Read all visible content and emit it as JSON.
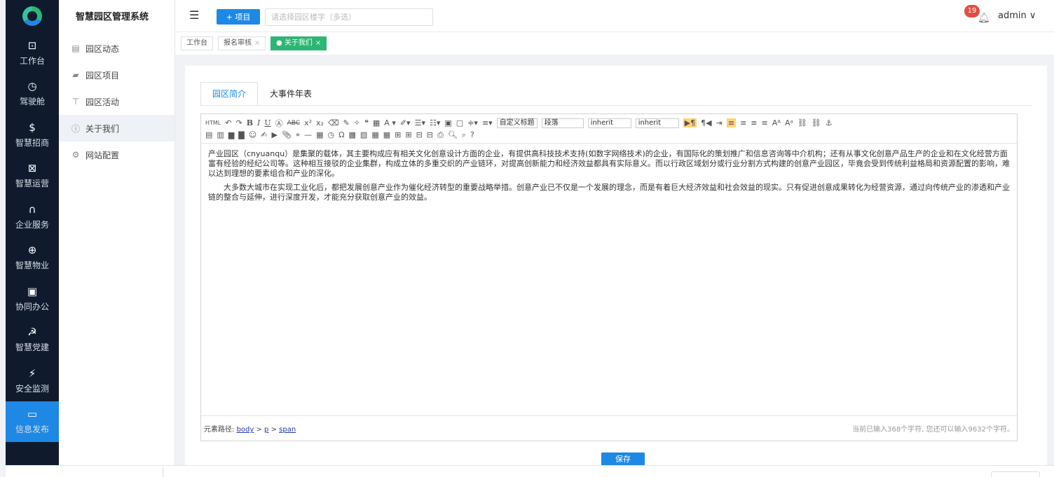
{
  "rail": {
    "items": [
      {
        "label": "工作台",
        "icon": "dashboard-icon",
        "glyph": "⊡",
        "active": false
      },
      {
        "label": "驾驶舱",
        "icon": "gauge-icon",
        "glyph": "◷",
        "active": false
      },
      {
        "label": "智慧招商",
        "icon": "money-icon",
        "glyph": "$",
        "active": false
      },
      {
        "label": "智慧运营",
        "icon": "chart-icon",
        "glyph": "⊠",
        "active": false
      },
      {
        "label": "企业服务",
        "icon": "headset-icon",
        "glyph": "∩",
        "active": false
      },
      {
        "label": "智慧物业",
        "icon": "property-icon",
        "glyph": "⊕",
        "active": false
      },
      {
        "label": "协同办公",
        "icon": "oa-icon",
        "glyph": "▣",
        "active": false
      },
      {
        "label": "智慧党建",
        "icon": "party-icon",
        "glyph": "☭",
        "active": false
      },
      {
        "label": "安全监测",
        "icon": "monitor-icon",
        "glyph": "⚡",
        "active": false
      },
      {
        "label": "信息发布",
        "icon": "screen-icon",
        "glyph": "▭",
        "active": true
      }
    ]
  },
  "sidebar": {
    "title": "智慧园区管理系统",
    "items": [
      {
        "label": "园区动态",
        "glyph": "▤"
      },
      {
        "label": "园区项目",
        "glyph": "▰"
      },
      {
        "label": "园区活动",
        "glyph": "⊤"
      },
      {
        "label": "关于我们",
        "glyph": "ⓘ"
      },
      {
        "label": "网站配置",
        "glyph": "⚙"
      }
    ]
  },
  "topbar": {
    "project_button": "+ 项目",
    "search_placeholder": "请选择园区楼字（多选）",
    "badge": "19",
    "user": "admin ∨"
  },
  "page_tabs": [
    {
      "label": "工作台",
      "closable": false
    },
    {
      "label": "报名审核",
      "closable": true
    },
    {
      "label": "● 关于我们",
      "closable": true,
      "active": true
    }
  ],
  "content_tabs": [
    "园区简介",
    "大事件年表"
  ],
  "toolbar": {
    "heading_select": "自定义标题",
    "para_select": "段落",
    "font_select": "inherit",
    "size_select": "inherit"
  },
  "editor": {
    "paragraphs": [
      "产业园区（cnyuanqu）是集聚的载体，其主要构成应有相关文化创意设计方面的企业，有提供高科技技术支持(如数字网络技术)的企业，有国际化的策划推广和信息咨询等中介机构；还有从事文化创意产品生产的企业和在文化经营方面富有经验的经纪公司等。这种相互接驳的企业集群，构成立体的多重交织的产业链环，对提高创新能力和经济效益都具有实际意义。而以行政区域划分或行业分割方式构建的创意产业园区，毕竟会受到传统利益格局和资源配置的影响，难以达到理想的要素组合和产业的深化。",
      "大多数大城市在实现工业化后，都把发展创意产业作为催化经济转型的重要战略举措。创意产业已不仅是一个发展的理念，而是有着巨大经济效益和社会效益的现实。只有促进创意成果转化为经营资源，通过向传统产业的渗透和产业链的整合与延伸，进行深度开发，才能充分获取创意产业的效益。"
    ],
    "path_label": "元素路径:",
    "path": [
      "body",
      "p",
      "span"
    ],
    "count": "当前已输入368个字符, 您还可以输入9632个字符。"
  },
  "save_button": "保存"
}
